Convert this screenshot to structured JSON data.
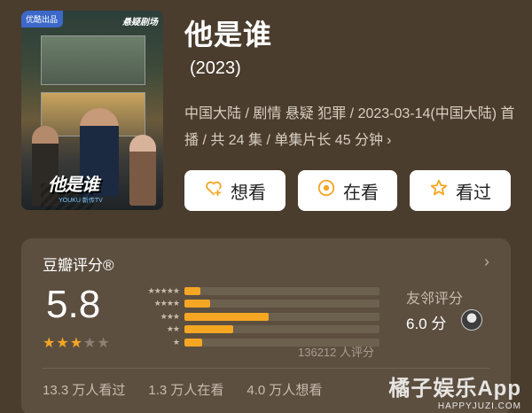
{
  "poster": {
    "badge": "优酷出品",
    "brand": "悬疑剧场",
    "title_art": "他是谁",
    "platforms": "YOUKU 新传TV"
  },
  "header": {
    "title": "他是谁",
    "year": "(2023)",
    "meta": "中国大陆 / 剧情 悬疑 犯罪 / 2023-03-14(中国大陆) 首播 / 共 24 集 / 单集片长 45 分钟",
    "meta_chevron": "›"
  },
  "actions": {
    "want_label": "想看",
    "watching_label": "在看",
    "watched_label": "看过"
  },
  "rating": {
    "header": "豆瓣评分®",
    "chevron": "›",
    "score": "5.8",
    "stars_filled": 3,
    "stars_total": 5,
    "distribution": [
      {
        "stars": "★★★★★",
        "fraction": 0.08
      },
      {
        "stars": "★★★★",
        "fraction": 0.13
      },
      {
        "stars": "★★★",
        "fraction": 0.43
      },
      {
        "stars": "★★",
        "fraction": 0.25
      },
      {
        "stars": "★",
        "fraction": 0.09
      }
    ],
    "count_text": "136212 人评分",
    "friend_label": "友邻评分",
    "friend_score": "6.0 分"
  },
  "stats": {
    "watched": "13.3 万人看过",
    "watching": "1.3 万人在看",
    "want": "4.0 万人想看"
  },
  "watermark": {
    "line1": "橘子娱乐App",
    "line2": "HAPPYJUZI.COM"
  },
  "colors": {
    "background": "#4a3d2d",
    "card": "#5c4f40",
    "accent_star": "#f5a623"
  }
}
